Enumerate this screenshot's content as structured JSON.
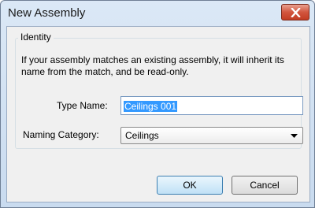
{
  "dialog": {
    "title": "New Assembly",
    "close_icon": "close-x-icon",
    "colors": {
      "close_button": "#c94a31",
      "selection": "#3399ff",
      "primary_button_border": "#3c7fb1"
    }
  },
  "identity": {
    "group_label": "Identity",
    "description": "If your assembly matches an existing assembly, it will inherit its name from the match, and be read-only.",
    "type_name_label": "Type Name:",
    "type_name_value": "Ceilings 001",
    "naming_category_label": "Naming Category:",
    "naming_category_value": "Ceilings",
    "dropdown_icon": "chevron-down-icon"
  },
  "buttons": {
    "ok": "OK",
    "cancel": "Cancel"
  }
}
